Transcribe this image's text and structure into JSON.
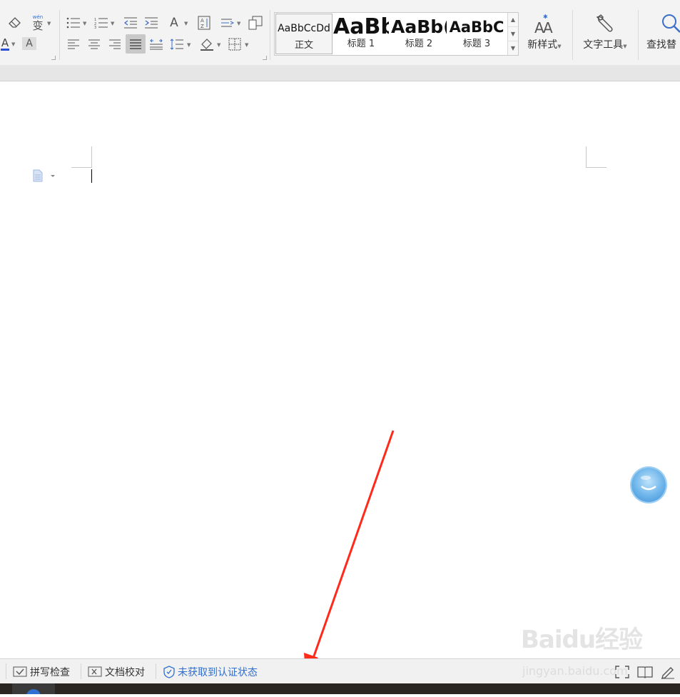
{
  "styles": {
    "items": [
      {
        "sample": "AaBbCcDd",
        "label": "正文"
      },
      {
        "sample": "AaBb",
        "label": "标题 1"
      },
      {
        "sample": "AaBb(",
        "label": "标题 2"
      },
      {
        "sample": "AaBbC",
        "label": "标题 3"
      }
    ]
  },
  "toolbar": {
    "new_style_label": "新样式",
    "text_tools_label": "文字工具",
    "find_replace_label": "查找替",
    "font_color_glyph": "A",
    "char_shading_glyph": "A",
    "phonetic_glyph": "变",
    "phonetic_small": "wén",
    "text_direction_glyph": "A"
  },
  "statusbar": {
    "spell_check": "拼写检查",
    "doc_proofread": "文档校对",
    "auth_status": "未获取到认证状态"
  },
  "watermark": {
    "logo": "Baidu经验",
    "url": "jingyan.baidu.com"
  },
  "colors": {
    "annotation_arrow": "#ff2a1a",
    "auth_status_text": "#2f6fd0"
  }
}
